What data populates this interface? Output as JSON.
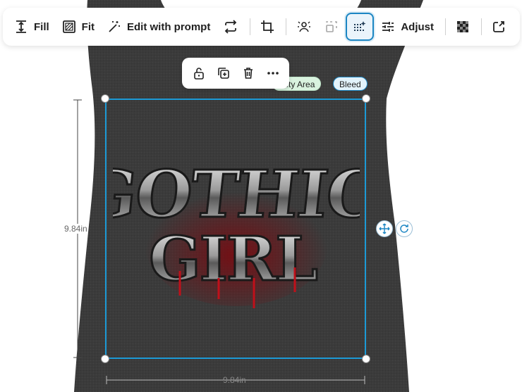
{
  "toolbar": {
    "fill_label": "Fill",
    "fit_label": "Fit",
    "edit_label": "Edit with prompt",
    "adjust_label": "Adjust"
  },
  "icons": {
    "fill": "fill-vertical-icon",
    "fit": "fit-icon",
    "edit": "magic-wand-icon",
    "swap": "swap-icon",
    "crop": "crop-icon",
    "remove_bg": "remove-background-icon",
    "smart_crop": "smart-crop-icon",
    "enhance": "enhance-sparkle-icon",
    "adjust": "sliders-icon",
    "transparency": "checkerboard-icon",
    "share": "export-icon",
    "unlock": "unlock-icon",
    "duplicate": "duplicate-icon",
    "delete": "trash-icon",
    "more": "more-dots-icon",
    "move": "move-icon",
    "rotate": "rotate-icon"
  },
  "badges": {
    "safety": "fety Area",
    "bleed": "Bleed"
  },
  "design": {
    "line1": "GOTHIC",
    "line2": "GIRL"
  },
  "dimensions": {
    "height": "9.84in",
    "width": "9.84in"
  },
  "colors": {
    "accent": "#1c86c3",
    "garment": "#3a3a3a",
    "drip": "#c0101a"
  }
}
